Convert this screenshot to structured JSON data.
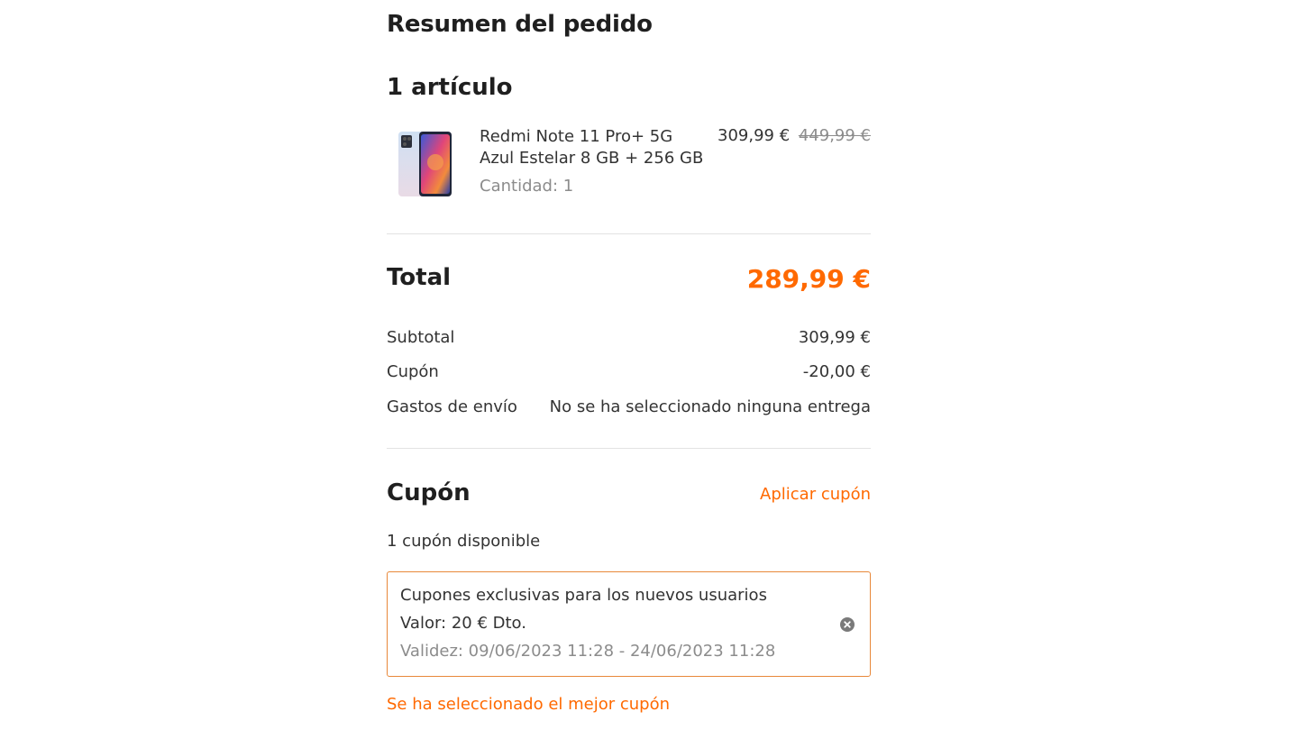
{
  "summary": {
    "title": "Resumen del pedido",
    "item_count": "1 artículo"
  },
  "product": {
    "name_line1": "Redmi Note 11 Pro+ 5G",
    "name_line2": "Azul Estelar 8 GB + 256 GB",
    "quantity": "Cantidad: 1",
    "price": "309,99 €",
    "original_price": "449,99 €",
    "thumbnail_icon": "smartphone-icon"
  },
  "totals": {
    "total_label": "Total",
    "total_value": "289,99 €",
    "rows": [
      {
        "label": "Subtotal",
        "value": "309,99 €"
      },
      {
        "label": "Cupón",
        "value": "-20,00 €"
      },
      {
        "label": "Gastos de envío",
        "value": "No se ha seleccionado ninguna entrega"
      }
    ]
  },
  "coupon": {
    "title": "Cupón",
    "apply_label": "Aplicar cupón",
    "available": "1 cupón disponible",
    "card": {
      "name": "Cupones exclusivas para los nuevos usuarios",
      "value": "Valor: 20 € Dto.",
      "validity": "Validez: 09/06/2023 11:28 - 24/06/2023 11:28",
      "close_icon": "close-circle-icon"
    },
    "best_note": "Se ha seleccionado el mejor cupón"
  },
  "colors": {
    "accent": "#ff6900",
    "coupon_border": "#e8883a",
    "muted_text": "#8c8c8c",
    "divider": "#e3e3e3"
  }
}
